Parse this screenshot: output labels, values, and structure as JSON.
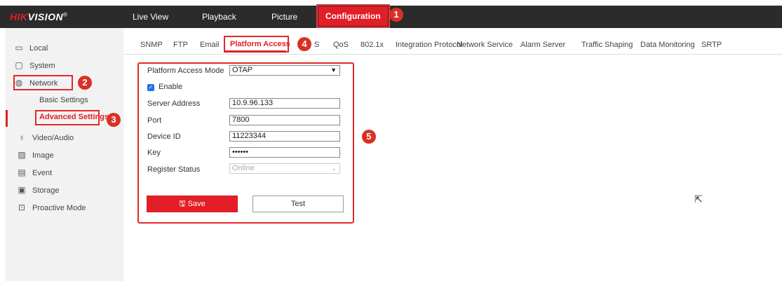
{
  "brand": {
    "logo_red": "HIK",
    "logo_white": "VISION",
    "registered": "®"
  },
  "topnav": {
    "live_view": "Live View",
    "playback": "Playback",
    "picture": "Picture",
    "configuration": "Configuration"
  },
  "callouts": [
    "1",
    "2",
    "3",
    "4",
    "5"
  ],
  "sidebar": {
    "local": "Local",
    "system": "System",
    "network": "Network",
    "basic_settings": "Basic Settings",
    "advanced_settings": "Advanced Settings",
    "video_audio": "Video/Audio",
    "image": "Image",
    "event": "Event",
    "storage": "Storage",
    "proactive_mode": "Proactive Mode"
  },
  "tabs": {
    "snmp": "SNMP",
    "ftp": "FTP",
    "email": "Email",
    "platform_access": "Platform Access",
    "https_partial": "S",
    "qos": "QoS",
    "dot1x": "802.1x",
    "integration_protocol": "Integration Protocol",
    "network_service": "Network Service",
    "alarm_server": "Alarm Server",
    "traffic_shaping": "Traffic Shaping",
    "data_monitoring": "Data Monitoring",
    "srtp": "SRTP"
  },
  "form": {
    "mode_label": "Platform Access Mode",
    "mode_value": "OTAP",
    "enable_label": "Enable",
    "server_label": "Server Address",
    "server_value": "10.9.96.133",
    "port_label": "Port",
    "port_value": "7800",
    "device_id_label": "Device ID",
    "device_id_value": "11223344",
    "key_label": "Key",
    "key_value": "••••••",
    "register_label": "Register Status",
    "register_value": "Online",
    "save_label": "Save",
    "test_label": "Test"
  },
  "colors": {
    "accent": "#e21e26",
    "callout": "#d93025",
    "topbar": "#2b2b2b",
    "checkbox": "#1a73e8"
  }
}
